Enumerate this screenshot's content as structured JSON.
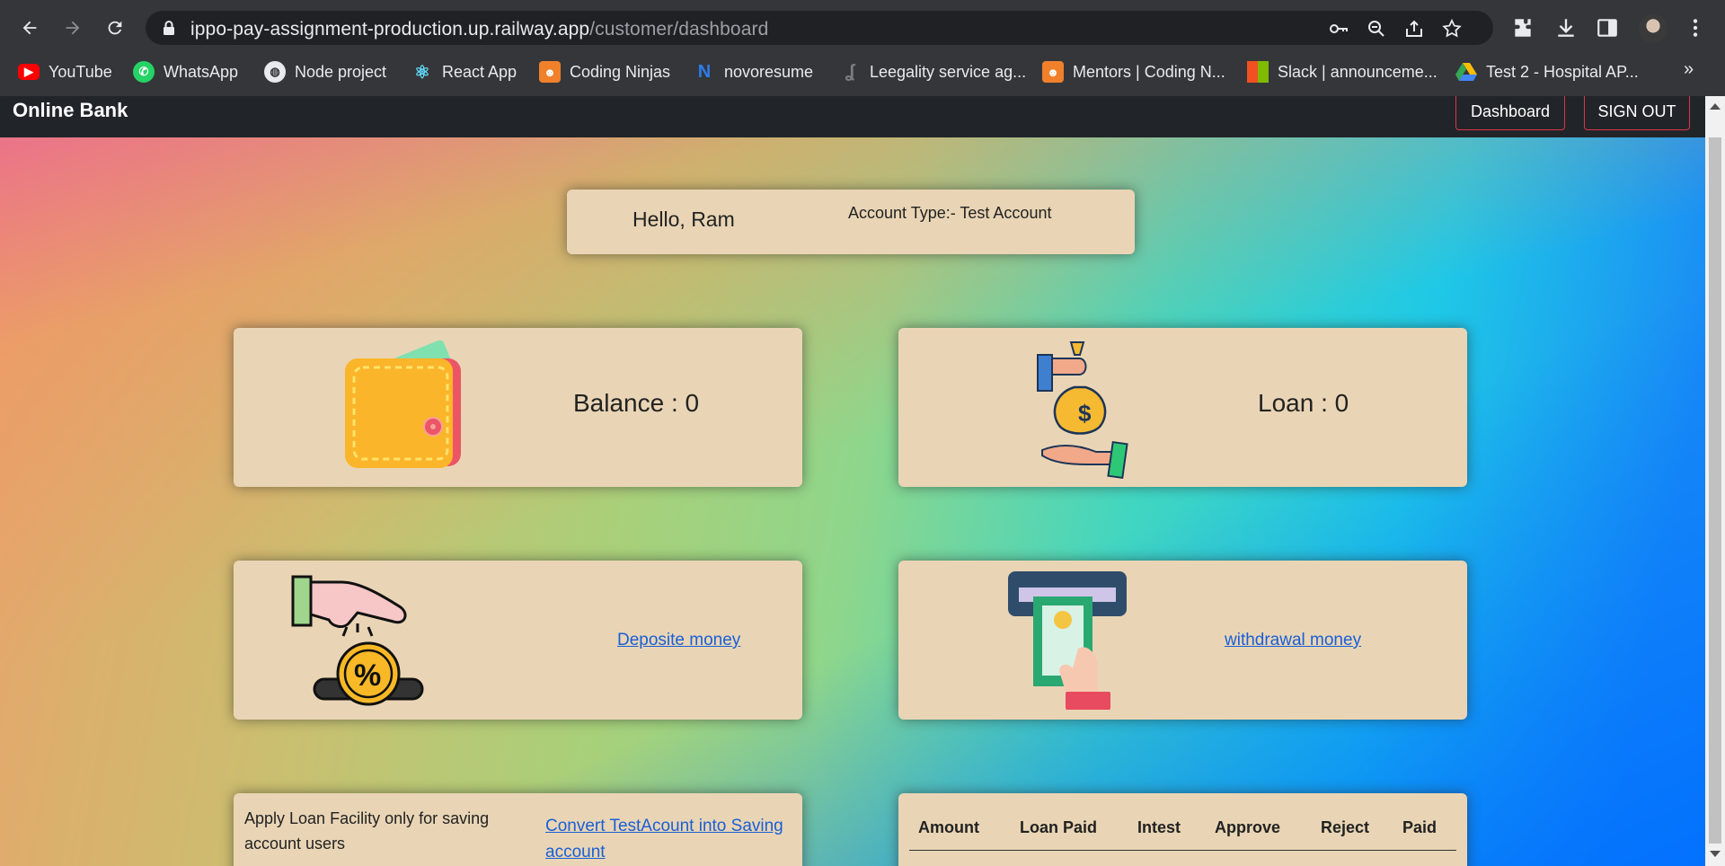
{
  "browser": {
    "url_host": "ippo-pay-assignment-production.up.railway.app",
    "url_path": "/customer/dashboard",
    "bookmarks": [
      {
        "label": "YouTube",
        "icon": "youtube-icon",
        "color": "#ff0000"
      },
      {
        "label": "WhatsApp",
        "icon": "whatsapp-icon",
        "color": "#25d366"
      },
      {
        "label": "Node project",
        "icon": "globe-icon",
        "color": "#e8eaed"
      },
      {
        "label": "React App",
        "icon": "react-icon",
        "color": "#61dafb"
      },
      {
        "label": "Coding Ninjas",
        "icon": "coding-ninjas-icon",
        "color": "#f0802a"
      },
      {
        "label": "novoresume",
        "icon": "novoresume-icon",
        "color": "#2b7de9"
      },
      {
        "label": "Leegality service ag...",
        "icon": "leegality-icon",
        "color": "#5f6368"
      },
      {
        "label": "Mentors | Coding N...",
        "icon": "coding-ninjas-icon",
        "color": "#f0802a"
      },
      {
        "label": "Slack | announceme...",
        "icon": "microsoft-icon",
        "color": "#f25022"
      },
      {
        "label": "Test 2 - Hospital AP...",
        "icon": "google-drive-icon",
        "color": "#34a853"
      }
    ],
    "more": "»"
  },
  "app": {
    "brand": "Online Bank",
    "nav": {
      "dashboard": "Dashboard",
      "signout": "SIGN OUT"
    },
    "greeting": "Hello, Ram",
    "account_type": "Account Type:- Test Account",
    "balance_label": "Balance : 0",
    "balance": 0,
    "loan_label": "Loan : 0",
    "loan": 0,
    "deposit_link": "Deposite money",
    "withdraw_link": "withdrawal money",
    "apply_text": "Apply Loan Facility only for saving account users",
    "convert_link": "Convert TestAcount into Saving account",
    "loan_table_headers": [
      "Amount",
      "Loan Paid",
      "Intest",
      "Approve",
      "Reject",
      "Paid"
    ],
    "colors": {
      "card": "#e9d5b5",
      "navbar": "#212529",
      "nav_border": "#dc3545",
      "link": "#1a5fd6"
    }
  }
}
